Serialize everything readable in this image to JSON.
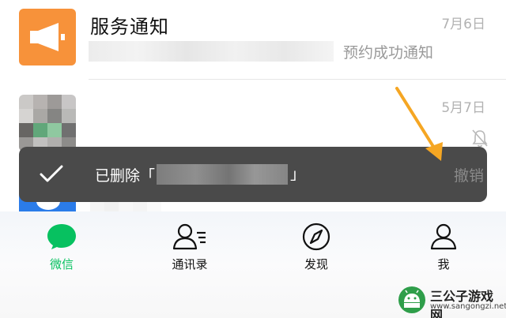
{
  "chats": [
    {
      "title": "服务通知",
      "date": "7月6日",
      "preview": "预约成功通知"
    },
    {
      "title": "",
      "date": "5月7日",
      "preview": ""
    }
  ],
  "toast": {
    "prefix": "已删除「",
    "suffix": "」",
    "action": "撤销"
  },
  "tabbar": {
    "tabs": [
      {
        "label": "微信",
        "icon": "chat-bubble-icon",
        "active": true
      },
      {
        "label": "通讯录",
        "icon": "contacts-icon",
        "active": false
      },
      {
        "label": "发现",
        "icon": "compass-icon",
        "active": false
      },
      {
        "label": "我",
        "icon": "person-icon",
        "active": false
      }
    ]
  },
  "watermark": {
    "title": "三公子游戏网",
    "url": "www.sangongzi.net"
  },
  "colors": {
    "accent_green": "#07c160",
    "notify_orange": "#f7923a",
    "arrow_orange": "#f5a623",
    "toast_bg": "#4a4a4a"
  }
}
